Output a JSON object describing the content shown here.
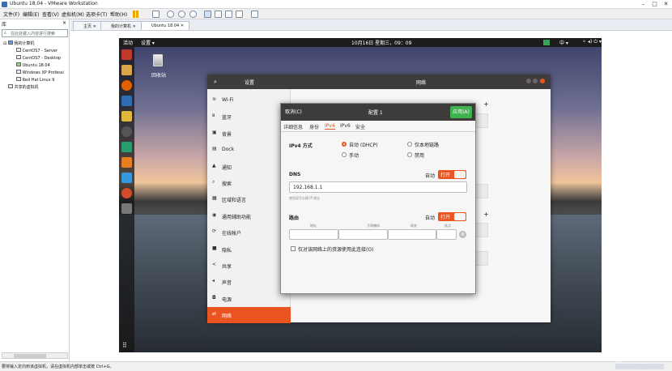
{
  "window": {
    "title": "Ubuntu 18.04 - VMware Workstation",
    "controls": [
      "–",
      "□",
      "✕"
    ]
  },
  "menubar": {
    "items": [
      "文件(F)",
      "编辑(E)",
      "查看(V)",
      "虚拟机(M)",
      "选项卡(T)",
      "帮助(H)"
    ]
  },
  "library": {
    "header": "库",
    "search_placeholder": "在此处键入内容进行搜索",
    "root": "我的计算机",
    "vms": [
      "CentOS7 - Server",
      "CentOS7 - Desktop",
      "Ubuntu 18.04",
      "Windows XP Professi",
      "Red Hat Linux 9"
    ],
    "shared": "共享的虚拟机"
  },
  "tabs": [
    {
      "label": "主页"
    },
    {
      "label": "我的计算机"
    },
    {
      "label": "Ubuntu 18.04"
    }
  ],
  "ubuntu": {
    "activities": "活动",
    "app_menu": "设置 ▾",
    "clock": "10月16日 星期三，09：09",
    "lang": "中 ▾",
    "trash_label": "回收站"
  },
  "settings": {
    "header_title": "设置",
    "page_title": "网络",
    "sidebar": [
      {
        "icon": "wifi-icon",
        "glyph": "≋",
        "label": "Wi-Fi"
      },
      {
        "icon": "bluetooth-icon",
        "glyph": "ʙ",
        "label": "蓝牙"
      },
      {
        "icon": "background-icon",
        "glyph": "▣",
        "label": "背景"
      },
      {
        "icon": "dock-icon",
        "glyph": "▤",
        "label": "Dock"
      },
      {
        "icon": "notification-icon",
        "glyph": "▲",
        "label": "通知"
      },
      {
        "icon": "search-icon",
        "glyph": "⌕",
        "label": "搜索"
      },
      {
        "icon": "region-icon",
        "glyph": "▦",
        "label": "区域和语言"
      },
      {
        "icon": "accessibility-icon",
        "glyph": "◉",
        "label": "通用辅助功能"
      },
      {
        "icon": "online-accounts-icon",
        "glyph": "⟳",
        "label": "在线帐户"
      },
      {
        "icon": "privacy-icon",
        "glyph": "■",
        "label": "隐私"
      },
      {
        "icon": "share-icon",
        "glyph": "<",
        "label": "共享"
      },
      {
        "icon": "sound-icon",
        "glyph": "◂",
        "label": "声音"
      },
      {
        "icon": "power-icon",
        "glyph": "◘",
        "label": "电源"
      },
      {
        "icon": "network-icon",
        "glyph": "⇄",
        "label": "网络"
      }
    ]
  },
  "dialog": {
    "cancel": "取消(C)",
    "title": "配置 1",
    "apply": "应用(A)",
    "tabs": [
      "详细信息",
      "身份",
      "IPv4",
      "IPv6",
      "安全"
    ],
    "ipv4_method_label": "IPv4 方式",
    "methods": [
      "自动 (DHCP)",
      "仅本地链路",
      "手动",
      "禁用"
    ],
    "dns_label": "DNS",
    "auto_label": "自动",
    "switch_on": "打开",
    "dns_value": "192.168.1.1",
    "dns_hint": "使用逗号分隔 IP 地址",
    "routes_label": "路由",
    "route_cols": [
      "地址",
      "子网掩码",
      "网关",
      "跃点"
    ],
    "only_local": "仅对该网络上的资源使用此连接(O)"
  },
  "statusbar": {
    "text": "要将输入定向到该虚拟机，请在虚拟机内部单击或按 Ctrl+G。"
  },
  "watermark": "CSDN @BAE_Ai"
}
